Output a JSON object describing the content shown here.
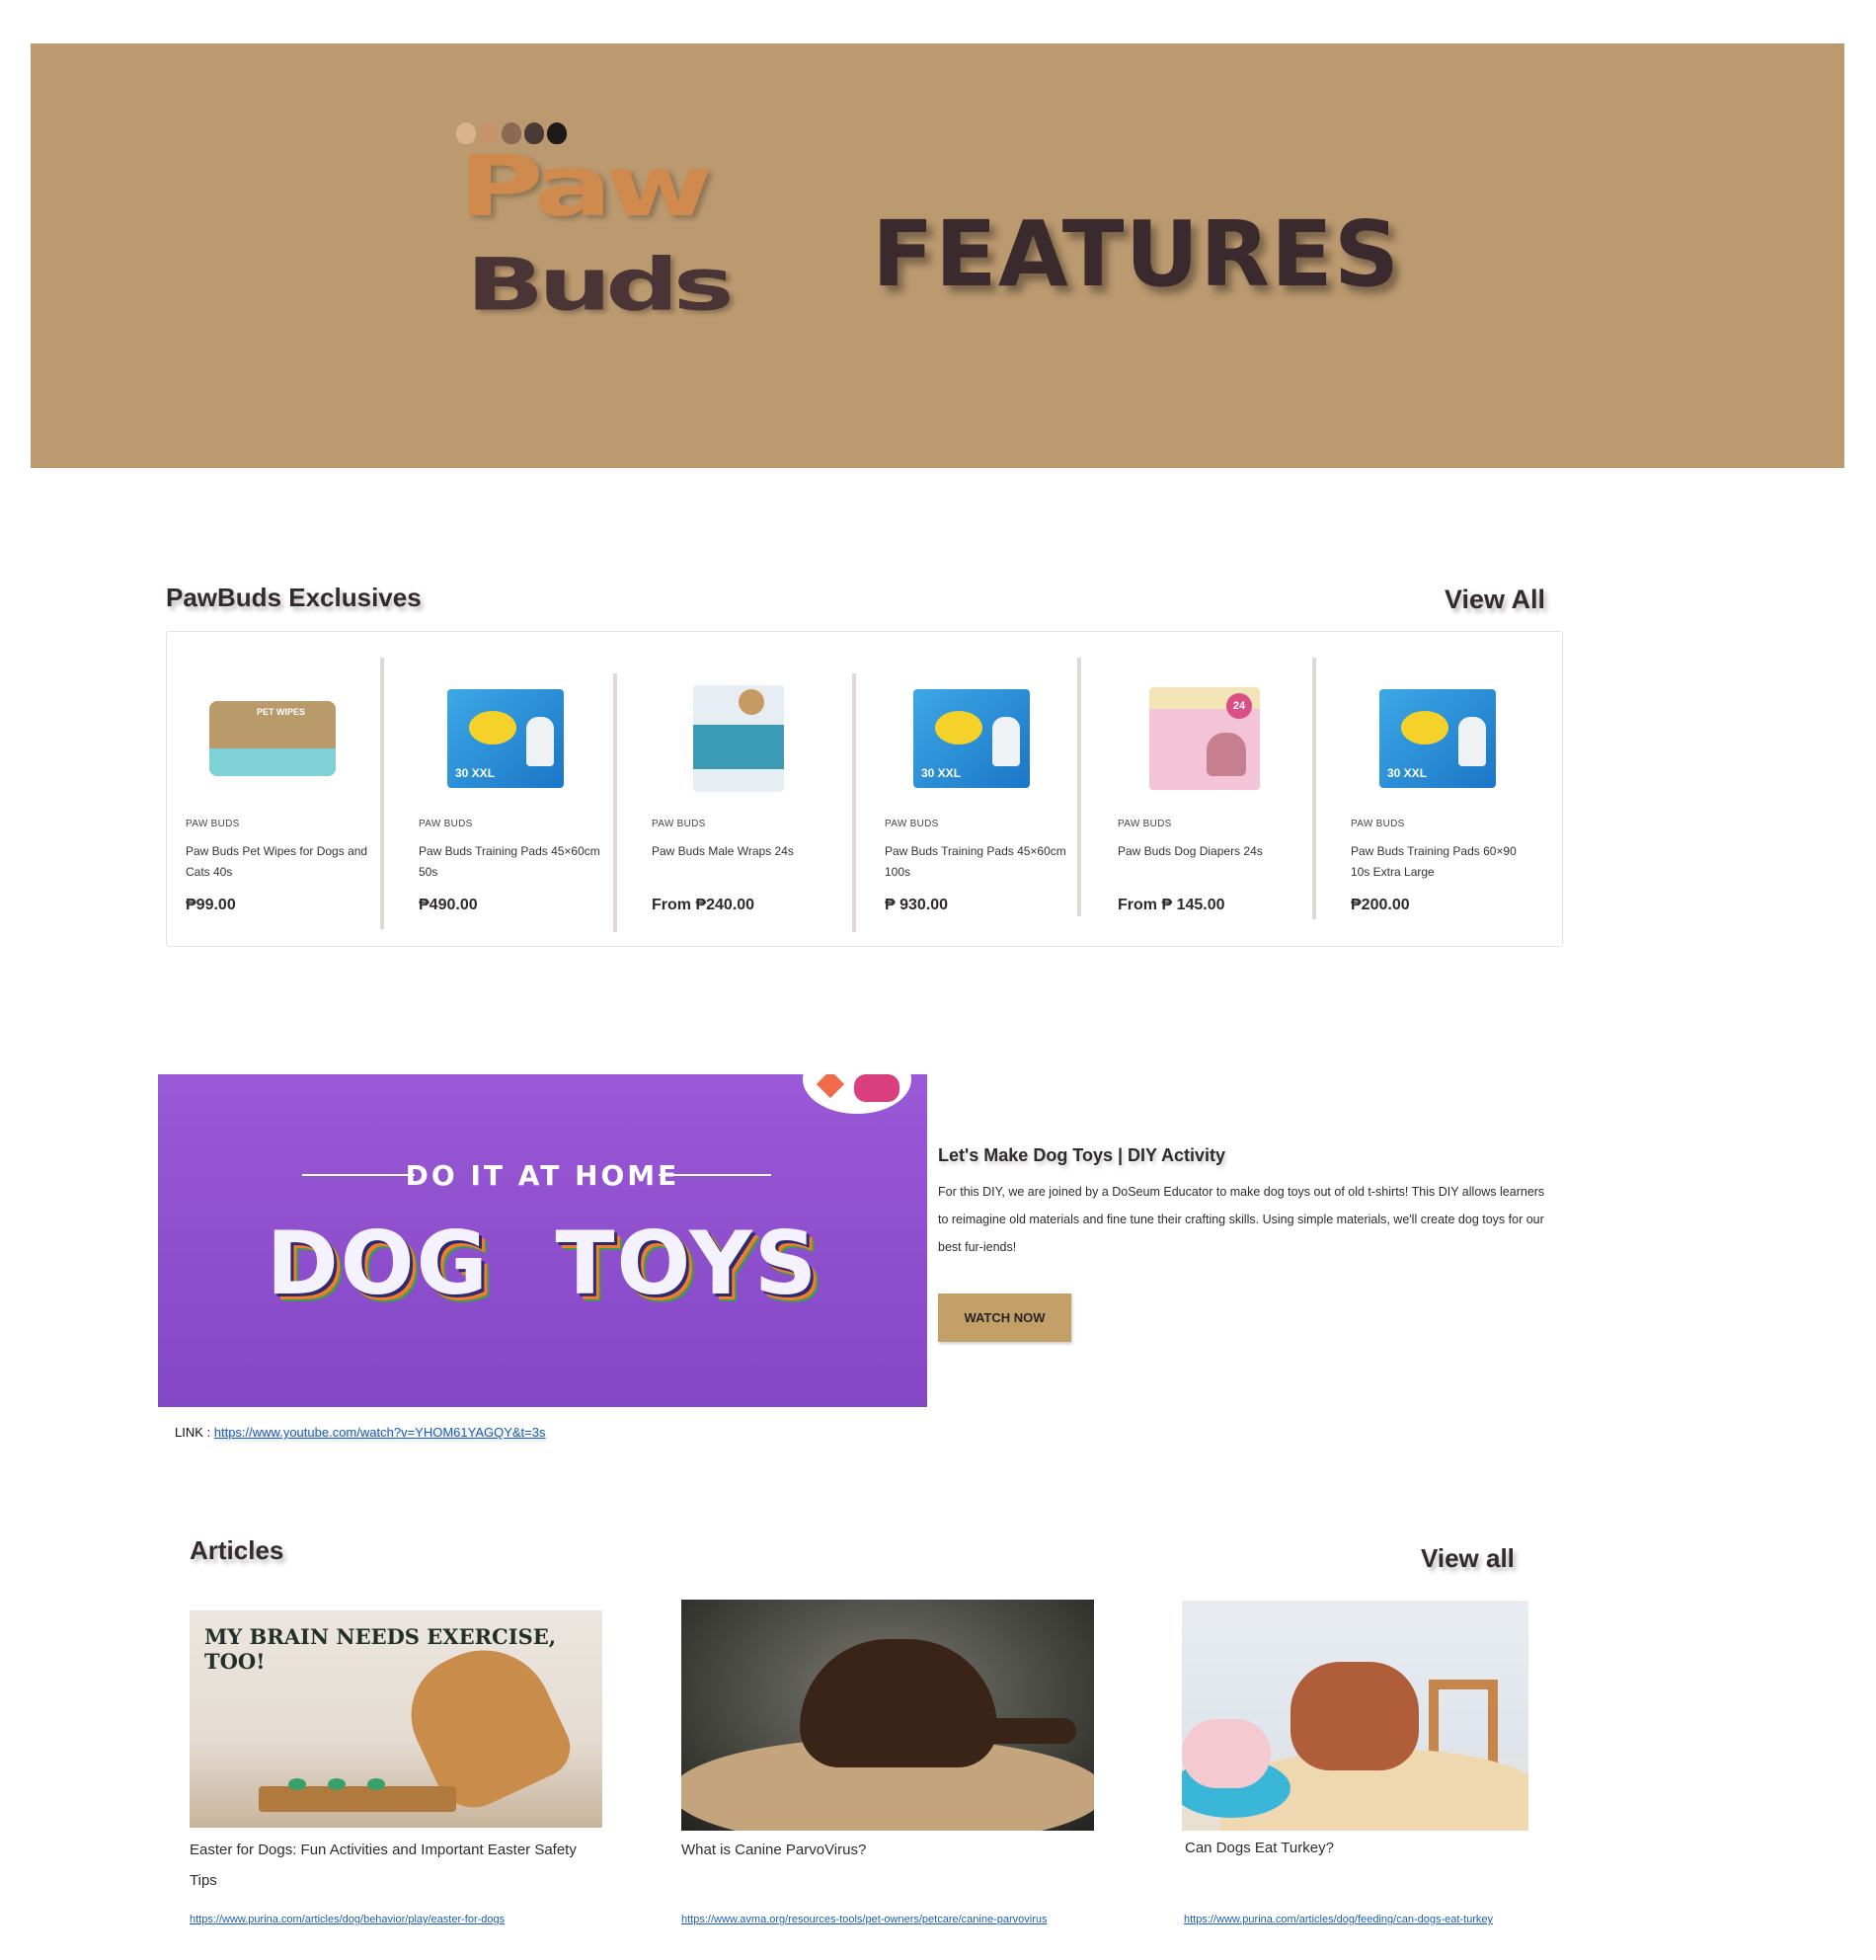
{
  "hero": {
    "logo_top": "Paw",
    "logo_bottom": "Buds",
    "title": "FEATURES",
    "background": "#bc9a70"
  },
  "exclusives": {
    "title": "PawBuds Exclusives",
    "view_all": "View All",
    "products": [
      {
        "brand": "PAW BUDS",
        "name": "Paw Buds Pet Wipes for Dogs and Cats 40s",
        "price": "₱99.00",
        "image": "pet-wipes-pack"
      },
      {
        "brand": "PAW BUDS",
        "name": "Paw Buds Training Pads 45×60cm 50s",
        "price": "₱490.00",
        "image": "training-pads-pack"
      },
      {
        "brand": "PAW BUDS",
        "name": "Paw Buds Male Wraps 24s",
        "price": "From ₱240.00",
        "image": "male-wraps-pack"
      },
      {
        "brand": "PAW BUDS",
        "name": "Paw Buds Training Pads 45×60cm 100s",
        "price": "₱ 930.00",
        "image": "training-pads-pack"
      },
      {
        "brand": "PAW BUDS",
        "name": "Paw Buds Dog Diapers 24s",
        "price": "From ₱ 145.00",
        "image": "dog-diapers-pack"
      },
      {
        "brand": "PAW BUDS",
        "name": "Paw Buds Training Pads 60×90 10s Extra Large",
        "price": "₱200.00",
        "image": "training-pads-pack"
      }
    ]
  },
  "video": {
    "banner_kicker": "DO IT AT HOME",
    "banner_title": "DOG TOYS",
    "title": "Let's Make Dog Toys | DIY Activity",
    "description": "For this DIY, we are joined by a DoSeum Educator to make dog toys out of old t-shirts! This DIY allows learners to reimagine old materials and fine tune their crafting skills. Using simple materials, we'll create dog toys for our best fur-iends!",
    "button": "WATCH NOW",
    "link_label": "LINK : ",
    "link_url": "https://www.youtube.com/watch?v=YHOM61YAGQY&t=3s"
  },
  "articles": {
    "title": "Articles",
    "view_all": "View all",
    "items": [
      {
        "title": "Easter for Dogs: Fun Activities and Important Easter Safety Tips",
        "url": "https://www.purina.com/articles/dog/behavior/play/easter-for-dogs",
        "image_text": "MY BRAIN NEEDS EXERCISE, TOO!"
      },
      {
        "title": "What is Canine ParvoVirus?",
        "url": "https://www.avma.org/resources-tools/pet-owners/petcare/canine-parvovirus"
      },
      {
        "title": "Can Dogs Eat Turkey?",
        "url": "https://www.purina.com/articles/dog/feeding/can-dogs-eat-turkey"
      }
    ]
  }
}
